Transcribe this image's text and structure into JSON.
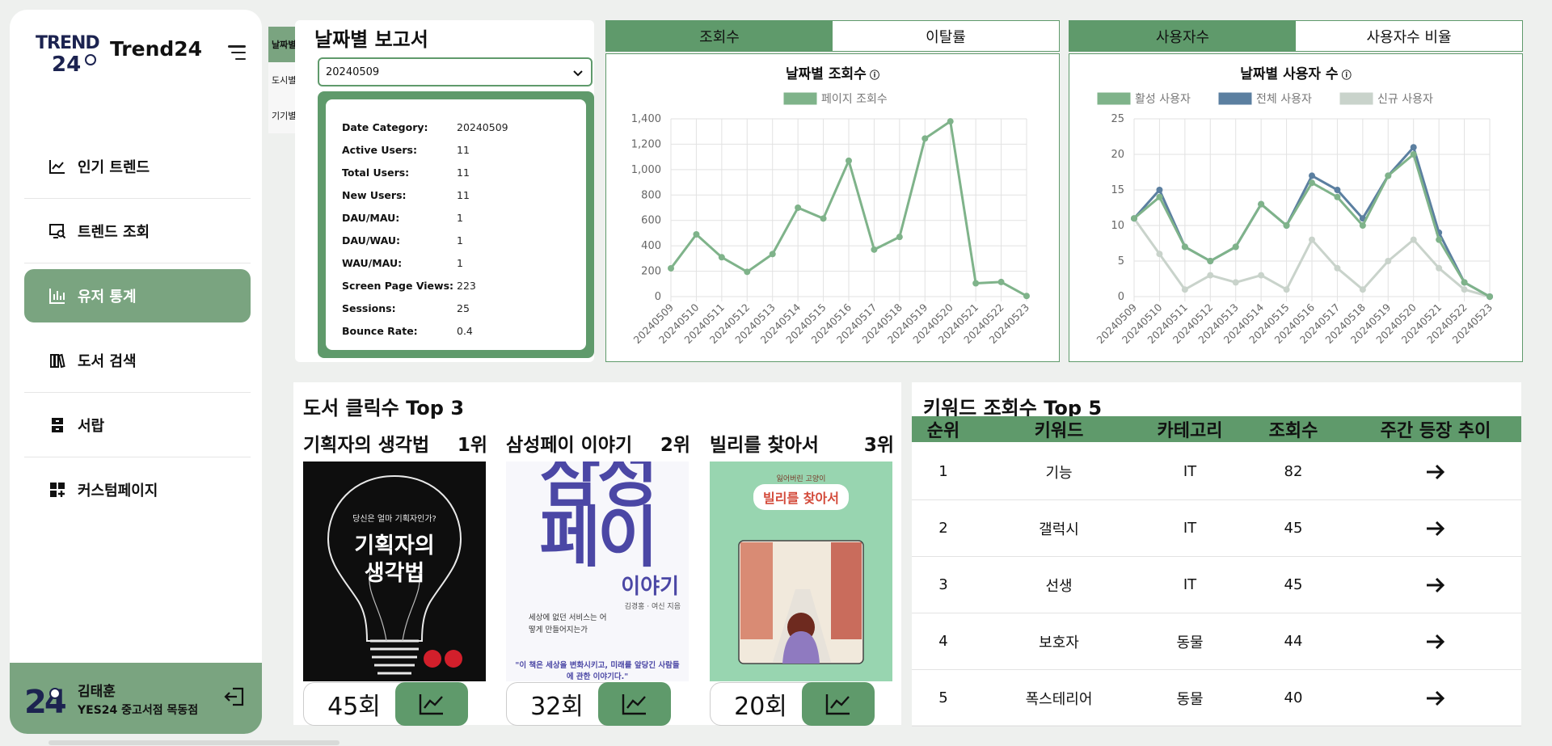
{
  "sidebar": {
    "brand": "Trend24",
    "logo_text": "TREND 24",
    "nav": [
      {
        "label": "인기 트렌드",
        "icon": "trend-line-icon"
      },
      {
        "label": "트렌드 조회",
        "icon": "search-monitor-icon"
      },
      {
        "label": "유저 통계",
        "icon": "bar-chart-icon",
        "active": true
      },
      {
        "label": "도서 검색",
        "icon": "books-icon"
      },
      {
        "label": "서랍",
        "icon": "drawer-icon"
      },
      {
        "label": "커스텀페이지",
        "icon": "grid-plus-icon"
      }
    ],
    "user": {
      "name": "김태훈",
      "store": "YES24 중고서점 목동점",
      "avatar_text": "24"
    }
  },
  "report": {
    "side_tabs": [
      "날짜별",
      "도시별",
      "기기별"
    ],
    "title": "날짜별 보고서",
    "selected_date": "20240509",
    "rows": [
      {
        "k": "Date Category:",
        "v": "20240509"
      },
      {
        "k": "Active Users:",
        "v": "11"
      },
      {
        "k": "Total Users:",
        "v": "11"
      },
      {
        "k": "New Users:",
        "v": "11"
      },
      {
        "k": "DAU/MAU:",
        "v": "1"
      },
      {
        "k": "DAU/WAU:",
        "v": "1"
      },
      {
        "k": "WAU/MAU:",
        "v": "1"
      },
      {
        "k": "Screen Page Views:",
        "v": "223"
      },
      {
        "k": "Sessions:",
        "v": "25"
      },
      {
        "k": "Bounce Rate:",
        "v": "0.4"
      }
    ]
  },
  "views_panel": {
    "tabs": [
      "조회수",
      "이탈률"
    ],
    "chart_title": "날짜별 조회수"
  },
  "users_panel": {
    "tabs": [
      "사용자수",
      "사용자수 비율"
    ],
    "chart_title": "날짜별 사용자 수"
  },
  "colors": {
    "accent": "#5f9a6b",
    "sidebar_active": "#7aa480",
    "active_users": "#7fb38a",
    "total_users": "#5b7fa0",
    "new_users": "#c9d3cb"
  },
  "chart_data": [
    {
      "type": "line",
      "title": "날짜별 조회수",
      "x": [
        "20240509",
        "20240510",
        "20240511",
        "20240512",
        "20240513",
        "20240514",
        "20240515",
        "20240516",
        "20240517",
        "20240518",
        "20240519",
        "20240520",
        "20240521",
        "20240522",
        "20240523"
      ],
      "series": [
        {
          "name": "페이지 조회수",
          "values": [
            223,
            490,
            310,
            195,
            335,
            700,
            615,
            1070,
            370,
            470,
            1245,
            1380,
            105,
            115,
            5
          ]
        }
      ],
      "ylim": [
        0,
        1400
      ],
      "yticks": [
        "0",
        "200",
        "400",
        "600",
        "800",
        "1,000",
        "1,200",
        "1,400"
      ],
      "grid": true,
      "legend": "top"
    },
    {
      "type": "line",
      "title": "날짜별 사용자 수",
      "x": [
        "20240509",
        "20240510",
        "20240511",
        "20240512",
        "20240513",
        "20240514",
        "20240515",
        "20240516",
        "20240517",
        "20240518",
        "20240519",
        "20240520",
        "20240521",
        "20240522",
        "20240523"
      ],
      "series": [
        {
          "name": "활성 사용자",
          "values": [
            11,
            14,
            7,
            5,
            7,
            13,
            10,
            16,
            14,
            10,
            17,
            20,
            8,
            2,
            0
          ]
        },
        {
          "name": "전체 사용자",
          "values": [
            11,
            15,
            7,
            5,
            7,
            13,
            10,
            17,
            15,
            11,
            17,
            21,
            9,
            2,
            0
          ]
        },
        {
          "name": "신규 사용자",
          "values": [
            11,
            6,
            1,
            3,
            2,
            3,
            1,
            8,
            4,
            1,
            5,
            8,
            4,
            1,
            0
          ]
        }
      ],
      "ylim": [
        0,
        25
      ],
      "yticks": [
        "0",
        "5",
        "10",
        "15",
        "20",
        "25"
      ],
      "grid": true,
      "legend": "top"
    }
  ],
  "books": {
    "title": "도서 클릭수 Top 3",
    "items": [
      {
        "title": "기획자의 생각법",
        "rank": "1위",
        "count": "45회",
        "cover": {
          "top": "당신은 얼마 기획자인가?",
          "main1": "기획자의",
          "main2": "생각법"
        }
      },
      {
        "title": "삼성페이 이야기",
        "rank": "2위",
        "count": "32회",
        "cover": {
          "main1": "삼성",
          "main2": "페이",
          "main3": "이야기",
          "author": "김경홍 · 여신 지음",
          "sub": "세상에 없던 서비스는 어떻게 만들어지는가",
          "quote": "\"이 책은 세상을 변화시키고, 미래를 앞당긴 사람들에 관한 이야기다.\""
        }
      },
      {
        "title": "빌리를 찾아서",
        "rank": "3위",
        "count": "20회",
        "cover": {
          "top": "잃어버린 고양이",
          "main1": "빌리를 찾아서"
        }
      }
    ]
  },
  "keywords": {
    "title": "키워드 조회수 Top 5",
    "headers": [
      "순위",
      "키워드",
      "카테고리",
      "조회수",
      "주간 등장 추이"
    ],
    "rows": [
      {
        "rank": "1",
        "keyword": "기능",
        "category": "IT",
        "views": "82"
      },
      {
        "rank": "2",
        "keyword": "갤럭시",
        "category": "IT",
        "views": "45"
      },
      {
        "rank": "3",
        "keyword": "선생",
        "category": "IT",
        "views": "45"
      },
      {
        "rank": "4",
        "keyword": "보호자",
        "category": "동물",
        "views": "44"
      },
      {
        "rank": "5",
        "keyword": "폭스테리어",
        "category": "동물",
        "views": "40"
      }
    ]
  }
}
